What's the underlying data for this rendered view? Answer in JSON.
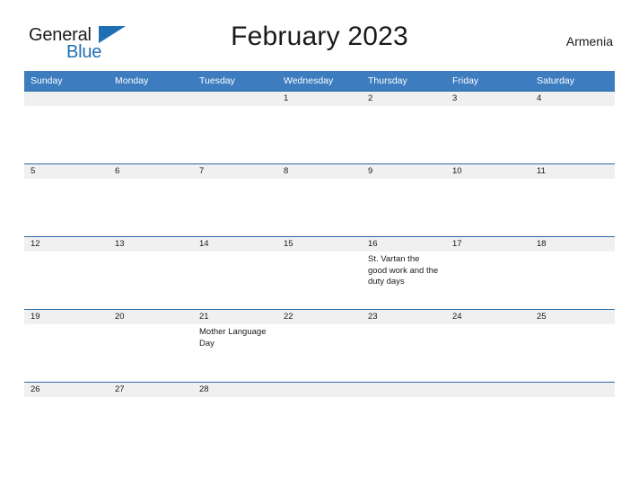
{
  "brand": {
    "name_part1": "General",
    "name_part2": "Blue",
    "flag_icon": "blue-flag-triangle",
    "color_primary": "#1f6fb5",
    "color_text": "#1c1c1c"
  },
  "header": {
    "title": "February 2023",
    "country": "Armenia",
    "header_bg_color": "#3c7cbf",
    "row_divider_color": "#2a6ba8",
    "daynum_band_color": "#f0f0f0"
  },
  "calendar": {
    "month": "February",
    "year": "2023",
    "weekday_headers": [
      "Sunday",
      "Monday",
      "Tuesday",
      "Wednesday",
      "Thursday",
      "Friday",
      "Saturday"
    ],
    "weeks": [
      {
        "days": [
          {
            "date": "",
            "event": ""
          },
          {
            "date": "",
            "event": ""
          },
          {
            "date": "",
            "event": ""
          },
          {
            "date": "1",
            "event": ""
          },
          {
            "date": "2",
            "event": ""
          },
          {
            "date": "3",
            "event": ""
          },
          {
            "date": "4",
            "event": ""
          }
        ]
      },
      {
        "days": [
          {
            "date": "5",
            "event": ""
          },
          {
            "date": "6",
            "event": ""
          },
          {
            "date": "7",
            "event": ""
          },
          {
            "date": "8",
            "event": ""
          },
          {
            "date": "9",
            "event": ""
          },
          {
            "date": "10",
            "event": ""
          },
          {
            "date": "11",
            "event": ""
          }
        ]
      },
      {
        "days": [
          {
            "date": "12",
            "event": ""
          },
          {
            "date": "13",
            "event": ""
          },
          {
            "date": "14",
            "event": ""
          },
          {
            "date": "15",
            "event": ""
          },
          {
            "date": "16",
            "event": "St. Vartan the good work and the duty days"
          },
          {
            "date": "17",
            "event": ""
          },
          {
            "date": "18",
            "event": ""
          }
        ]
      },
      {
        "days": [
          {
            "date": "19",
            "event": ""
          },
          {
            "date": "20",
            "event": ""
          },
          {
            "date": "21",
            "event": "Mother Language Day"
          },
          {
            "date": "22",
            "event": ""
          },
          {
            "date": "23",
            "event": ""
          },
          {
            "date": "24",
            "event": ""
          },
          {
            "date": "25",
            "event": ""
          }
        ]
      },
      {
        "days": [
          {
            "date": "26",
            "event": ""
          },
          {
            "date": "27",
            "event": ""
          },
          {
            "date": "28",
            "event": ""
          },
          {
            "date": "",
            "event": ""
          },
          {
            "date": "",
            "event": ""
          },
          {
            "date": "",
            "event": ""
          },
          {
            "date": "",
            "event": ""
          }
        ]
      }
    ]
  }
}
